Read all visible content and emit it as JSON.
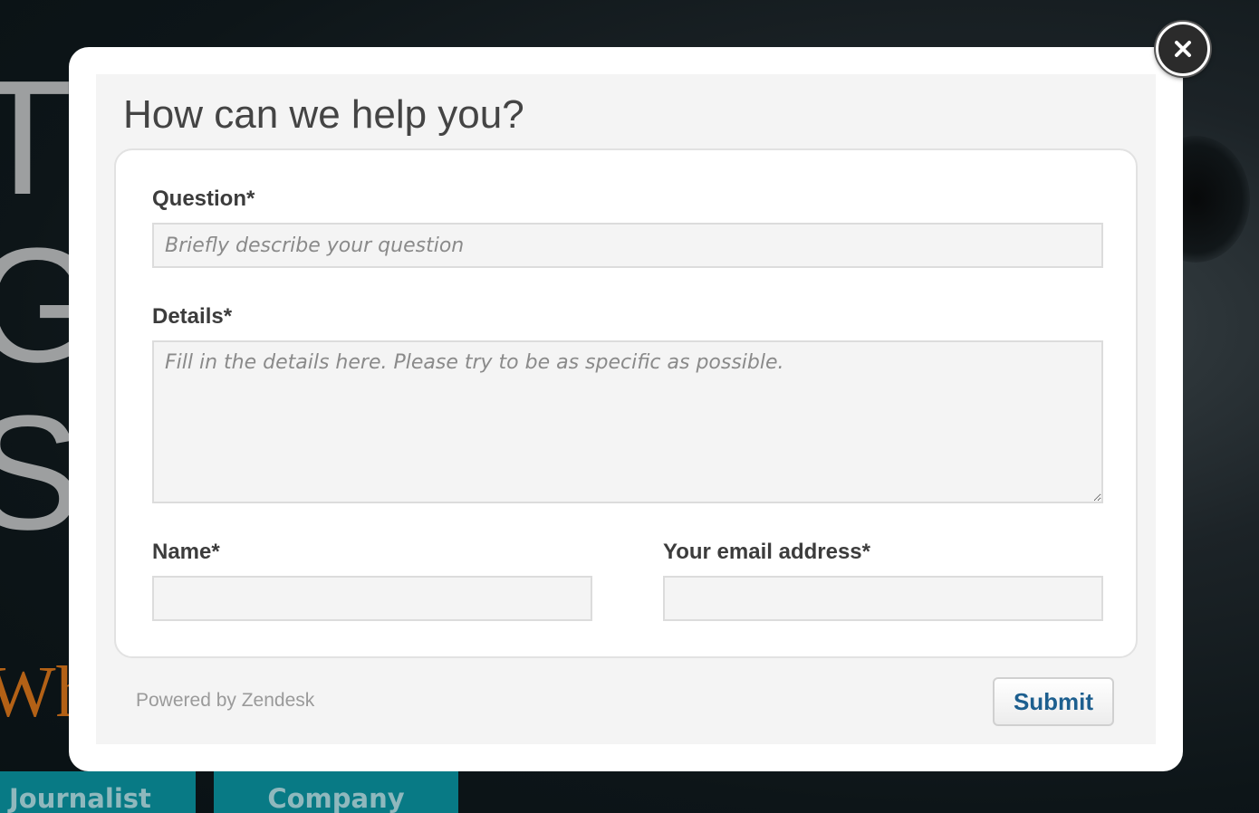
{
  "background": {
    "big_letters": "T\nG\nS",
    "subtitle_fragment": "Whic",
    "buttons": [
      "Journalist",
      "Company"
    ]
  },
  "modal": {
    "title": "How can we help you?",
    "question": {
      "label": "Question*",
      "placeholder": "Briefly describe your question",
      "value": ""
    },
    "details": {
      "label": "Details*",
      "placeholder": "Fill in the details here. Please try to be as specific as possible.",
      "value": ""
    },
    "name": {
      "label": "Name*",
      "value": ""
    },
    "email": {
      "label": "Your email address*",
      "value": ""
    },
    "powered_by": "Powered by Zendesk",
    "submit_label": "Submit",
    "close_icon": "close-icon"
  },
  "colors": {
    "submit_text": "#1d5f8f",
    "background_button": "#087a85",
    "background_accent": "#b36116"
  }
}
